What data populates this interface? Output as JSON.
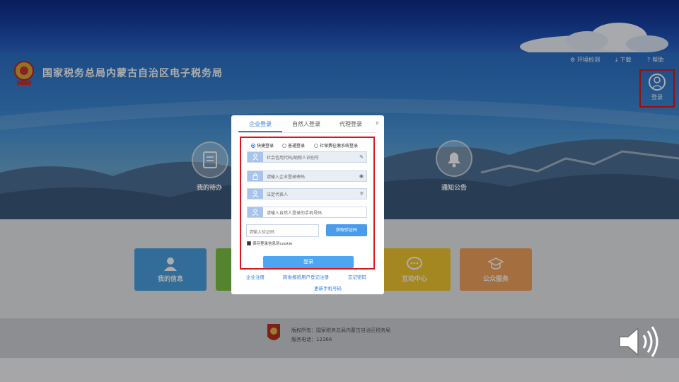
{
  "header": {
    "site_title": "国家税务总局内蒙古自治区电子税务局",
    "tools": [
      "环境检测",
      "下载",
      "帮助"
    ],
    "login_label": "登录"
  },
  "quick_links": [
    "我的待办",
    "通知公告"
  ],
  "tiles": [
    {
      "label": "我的信息",
      "color": "#4a9fe0",
      "icon": "user-icon"
    },
    {
      "label": "",
      "color": "#7cc444",
      "icon": ""
    },
    {
      "label": "互动中心",
      "color": "#f3c832",
      "icon": "chat-icon"
    },
    {
      "label": "公众服务",
      "color": "#f3a35c",
      "icon": "graduation-cap-icon"
    }
  ],
  "footer": {
    "copyright": "版权所有：国家税务总局内蒙古自治区税务局",
    "phone": "服务电话：12366"
  },
  "modal": {
    "tabs": [
      "企业登录",
      "自然人登录",
      "代理登录"
    ],
    "active_tab": 0,
    "close": "x",
    "login_modes": [
      "快捷登录",
      "普通登录",
      "社保费征缴系统登录"
    ],
    "selected_mode": 0,
    "credit_code_placeholder": "社会信用代码/纳税人识别号",
    "password_placeholder": "请输入企业登录密码",
    "role_select": "法定代表人",
    "phone_placeholder": "请输入自然人登录的手机号码",
    "captcha_placeholder": "请输入验证码",
    "get_code_label": "获取验证码",
    "remember_label": "保存登录信息到cookie",
    "remember_checked": true,
    "submit_label": "登录",
    "links": {
      "register": "企业注册",
      "cross_region": "跨省报验用户登记注册",
      "forgot": "忘记密码",
      "change_phone": "更新手机号码"
    }
  },
  "colors": {
    "accent": "#2f7de0",
    "highlight_box": "#e0151c"
  }
}
